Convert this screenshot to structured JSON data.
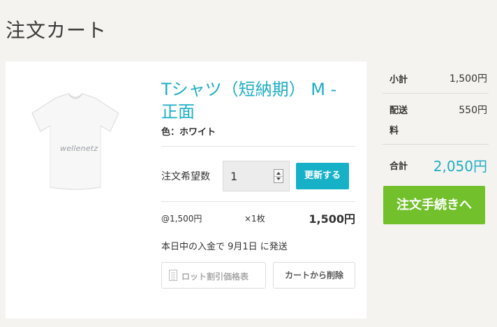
{
  "page": {
    "title": "注文カート"
  },
  "product": {
    "title": "Tシャツ（短納期） M - 正面",
    "color": "色：ホワイト",
    "image_logo": "wellenetz",
    "quantity_label": "注文希望数",
    "quantity_value": "1",
    "update_label": "更新する",
    "unit_price": "@1,500円",
    "multiplier": "×1枚",
    "line_total": "1,500円",
    "shipping_note": "本日中の入金で 9月1日 に発送",
    "lot_table_label": "ロット割引価格表",
    "remove_label": "カートから削除"
  },
  "summary": {
    "subtotal_label": "小計",
    "subtotal_value": "1,500円",
    "shipping_label_1": "配送",
    "shipping_label_2": "料",
    "shipping_value": "550円",
    "total_label": "合計",
    "total_value": "2,050円",
    "checkout_label": "注文手続きへ"
  },
  "colors": {
    "accent": "#1eaec4",
    "update_button": "#16b1c7",
    "checkout_button": "#72c02c",
    "background": "#f5f3ef"
  },
  "icons": [
    "document-icon",
    "stepper-up-icon",
    "stepper-down-icon"
  ]
}
